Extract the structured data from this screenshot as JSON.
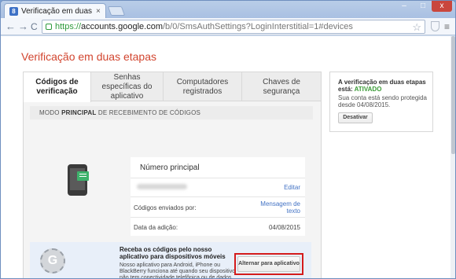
{
  "browser": {
    "tab_title": "Verificação em duas etapa",
    "tab_close": "×",
    "url_scheme": "https://",
    "url_host": "accounts.google.com",
    "url_path": "/b/0/SmsAuthSettings?LoginInterstitial=1#devices",
    "back": "←",
    "forward": "→",
    "reload": "C",
    "star": "☆",
    "menu": "≡",
    "min": "–",
    "max": "□",
    "close": "x"
  },
  "page": {
    "title": "Verificação em duas etapas",
    "tabs": [
      {
        "label": "Códigos de verificação"
      },
      {
        "label": "Senhas específicas do aplicativo"
      },
      {
        "label": "Computadores registrados"
      },
      {
        "label": "Chaves de segurança"
      }
    ],
    "section_header_pre": "MODO ",
    "section_header_bold": "PRINCIPAL",
    "section_header_post": " DE RECEBIMENTO DE CÓDIGOS",
    "phone": {
      "title": "Número principal",
      "edit_label": "Editar",
      "sent_via_label": "Códigos enviados por:",
      "sent_via_value": "Mensagem de texto",
      "added_label": "Data da adição:",
      "added_value": "04/08/2015"
    },
    "promo": {
      "title": "Receba os códigos pelo nosso aplicativo para dispositivos móveis",
      "description": "Nosso aplicativo para Android, iPhone ou BlackBerry funciona até quando seu dispositivo não tem conectividade telefônica ou de dados.",
      "button": "Alternar para aplicativo",
      "icon_letter": "G"
    },
    "side": {
      "title_pre": "A verificação em duas etapas está: ",
      "status": "ATIVADO",
      "description": "Sua conta está sendo protegida desde 04/08/2015.",
      "button": "Desativar"
    }
  },
  "colors": {
    "accent_title": "#d2452f",
    "status_green": "#3a9a36",
    "highlight_red": "#d41b1b",
    "link_blue": "#4272c4"
  }
}
